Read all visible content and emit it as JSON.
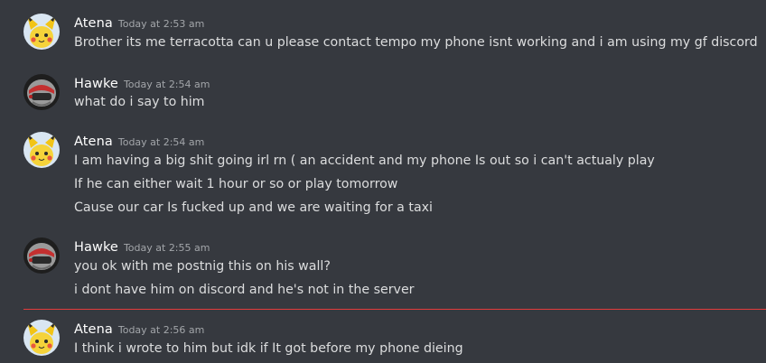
{
  "colors": {
    "background": "#36393f",
    "username": "#ffffff",
    "timestamp": "#a3a6aa",
    "message_text": "#dcddde",
    "new_messages_divider": "#e23c3c"
  },
  "messages": [
    {
      "author": "Atena",
      "avatar_icon": "pikachu-avatar-icon",
      "timestamp": "Today at 2:53 am",
      "lines": [
        "Brother its me terracotta can u please contact tempo my phone isnt working and i am using my gf discord"
      ]
    },
    {
      "author": "Hawke",
      "avatar_icon": "helmet-avatar-icon",
      "timestamp": "Today at 2:54 am",
      "lines": [
        "what do i say to him"
      ]
    },
    {
      "author": "Atena",
      "avatar_icon": "pikachu-avatar-icon",
      "timestamp": "Today at 2:54 am",
      "lines": [
        "I am having a big shit going irl rn ( an accident and my phone Is out so i can't actualy play",
        "If he can either wait 1 hour or so or play tomorrow",
        "Cause our car Is fucked up and we are waiting for a taxi"
      ]
    },
    {
      "author": "Hawke",
      "avatar_icon": "helmet-avatar-icon",
      "timestamp": "Today at 2:55 am",
      "lines": [
        "you ok with me postnig this on his wall?",
        "i dont have him on discord and he's not in the server"
      ]
    },
    {
      "author": "Atena",
      "avatar_icon": "pikachu-avatar-icon",
      "timestamp": "Today at 2:56 am",
      "lines": [
        "I think i wrote to him but idk if It got before my phone dieing"
      ]
    }
  ]
}
